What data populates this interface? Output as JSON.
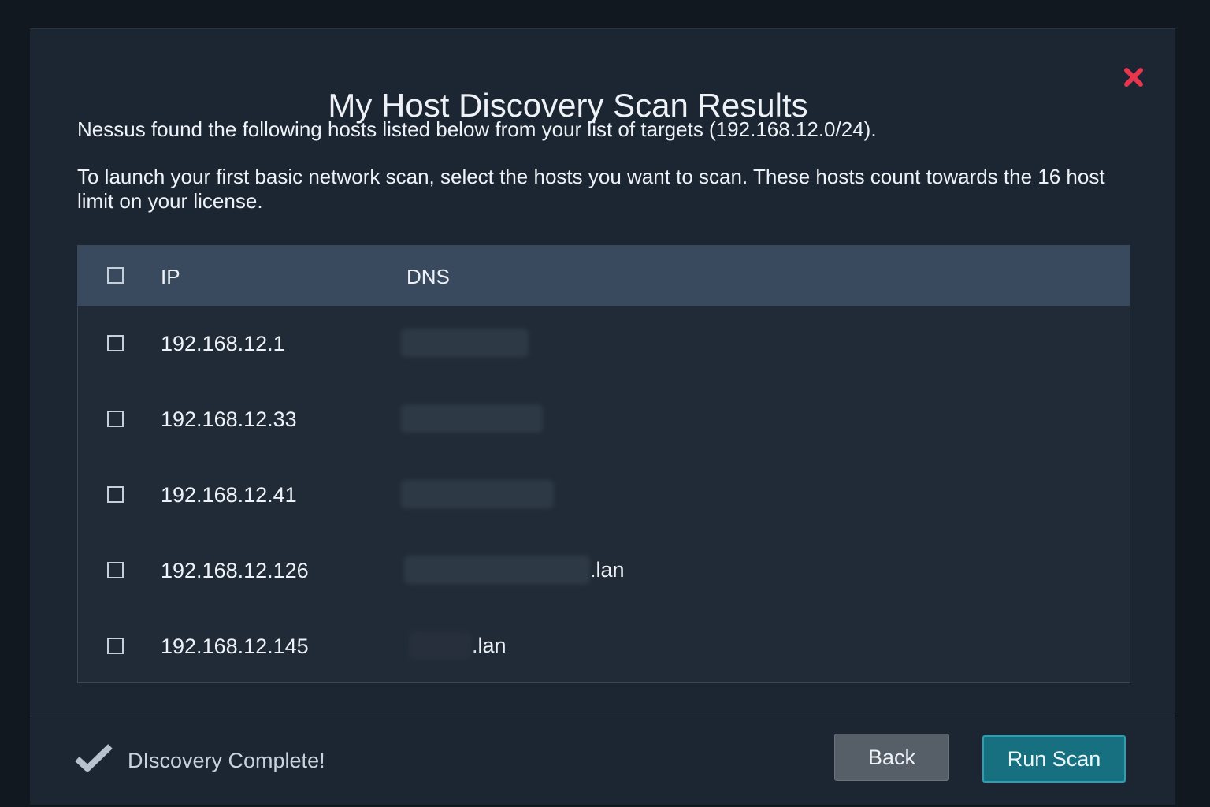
{
  "dialog": {
    "title": "My Host Discovery Scan Results",
    "close_icon": "close-x-icon",
    "intro": "Nessus found the following hosts listed below from your list of targets (192.168.12.0/24).",
    "instructions": "To launch your first basic network scan, select the hosts you want to scan. These hosts count towards the 16 host limit on your license."
  },
  "table": {
    "columns": {
      "ip": "IP",
      "dns": "DNS"
    },
    "rows": [
      {
        "ip": "192.168.12.1",
        "dns_suffix": ""
      },
      {
        "ip": "192.168.12.33",
        "dns_suffix": ""
      },
      {
        "ip": "192.168.12.41",
        "dns_suffix": ""
      },
      {
        "ip": "192.168.12.126",
        "dns_suffix": ".lan"
      },
      {
        "ip": "192.168.12.145",
        "dns_suffix": ".lan"
      }
    ]
  },
  "footer": {
    "status_icon": "checkmark-icon",
    "status_text": "DIscovery Complete!",
    "back_label": "Back",
    "run_label": "Run Scan"
  },
  "colors": {
    "close": "#e8364f",
    "run_button": "#16707f",
    "run_button_border": "#27a1b4",
    "back_button": "#565e68",
    "header_row": "#3a4a5e"
  }
}
